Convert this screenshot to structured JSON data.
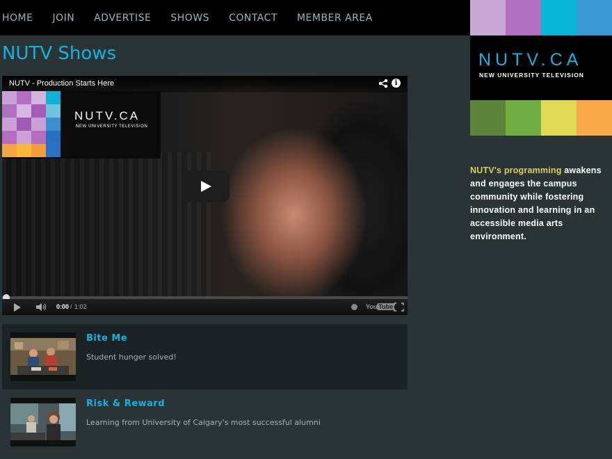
{
  "nav": {
    "items": [
      "HOME",
      "JOIN",
      "ADVERTISE",
      "SHOWS",
      "CONTACT",
      "MEMBER AREA"
    ]
  },
  "page": {
    "title": "NUTV Shows"
  },
  "player": {
    "title": "NUTV - Production Starts Here",
    "overlay_brand": "NUTV.CA",
    "overlay_tagline": "NEW UNIVERSITY TELEVISION",
    "time_current": "0:00",
    "time_separator": " / ",
    "time_total": "1:02",
    "logo_you": "You",
    "logo_tube": "Tube",
    "progress": 0.0
  },
  "shows": [
    {
      "title": "Bite Me",
      "description": "Student hunger solved!"
    },
    {
      "title": "Risk & Reward",
      "description": "Learning from University of Calgary's most successful alumni"
    }
  ],
  "sidebar": {
    "logo_text": "NUTV.CA",
    "logo_subtitle": "NEW UNIVERSITY TELEVISION",
    "description_highlight": "NUTV's programming",
    "description_rest": " awakens and engages the campus community while fostering innovation and learning in an accessible media arts environment.",
    "top_colors": [
      "#c8a7d6",
      "#b06fbf",
      "#0ab6d8",
      "#3d98d6"
    ],
    "bottom_colors": [
      "#5c843d",
      "#70ad43",
      "#dfd956",
      "#f9a84a"
    ]
  },
  "overlay_grid_colors": [
    "#c9a1d4",
    "#b36ec0",
    "#d5b3df",
    "#0fb1d6",
    "#b06fbf",
    "#d9b5e2",
    "#a55cb6",
    "#6cc5dd",
    "#c9a1d4",
    "#a15bb2",
    "#c9a1d4",
    "#3d8fd0",
    "#b36ec0",
    "#c9a1d4",
    "#b36ec0",
    "#2570c0",
    "#f3a444",
    "#fbb53b",
    "#f39e3c",
    "#2d72c2"
  ]
}
